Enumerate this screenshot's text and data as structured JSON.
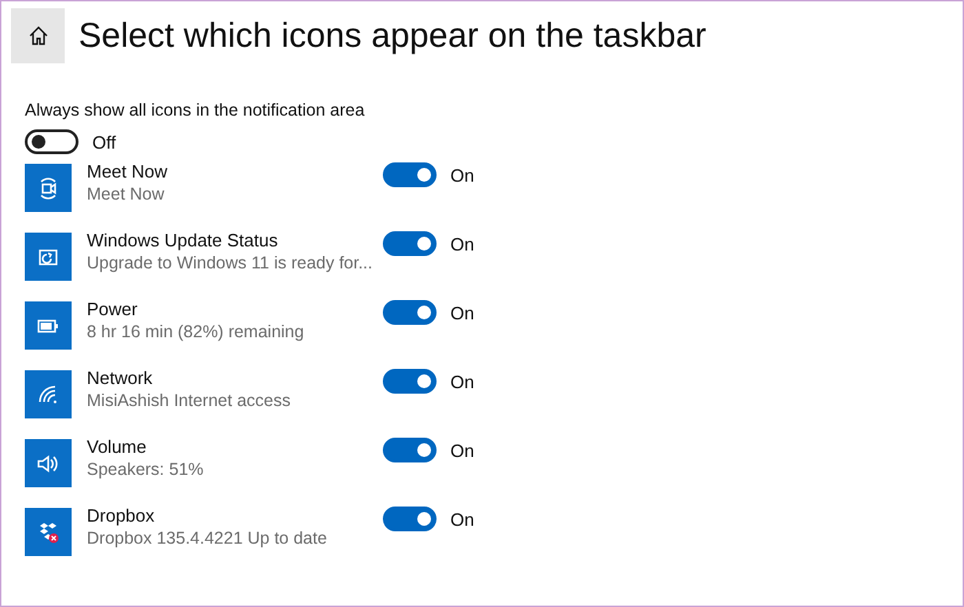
{
  "header": {
    "title": "Select which icons appear on the taskbar"
  },
  "always_show": {
    "label": "Always show all icons in the notification area",
    "on": false,
    "state_label": "Off"
  },
  "items": [
    {
      "name": "Meet Now",
      "detail": "Meet Now",
      "on": true,
      "state_label": "On"
    },
    {
      "name": "Windows Update Status",
      "detail": "Upgrade to Windows 11 is ready for...",
      "on": true,
      "state_label": "On"
    },
    {
      "name": "Power",
      "detail": "8 hr 16 min (82%) remaining",
      "on": true,
      "state_label": "On"
    },
    {
      "name": "Network",
      "detail": "MisiAshish Internet access",
      "on": true,
      "state_label": "On"
    },
    {
      "name": "Volume",
      "detail": "Speakers: 51%",
      "on": true,
      "state_label": "On"
    },
    {
      "name": "Dropbox",
      "detail": "Dropbox 135.4.4221 Up to date",
      "on": true,
      "state_label": "On"
    }
  ]
}
